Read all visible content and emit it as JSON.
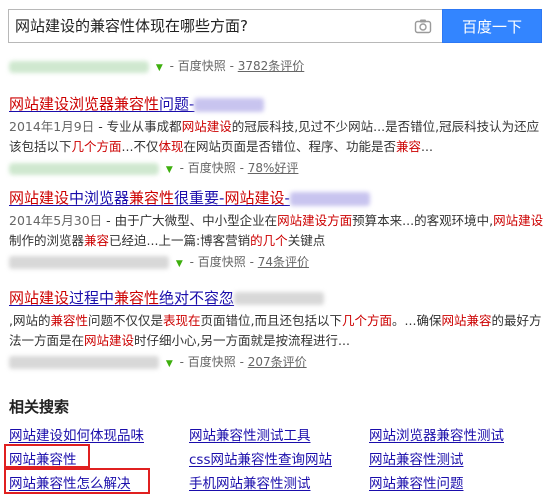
{
  "search": {
    "query": "网站建设的兼容性体现在哪些方面?",
    "button_label": "百度一下"
  },
  "top_meta": {
    "snapshot": "百度快照",
    "reviews": "3782条评价"
  },
  "results": [
    {
      "title_parts": [
        {
          "t": "网站建设浏览器",
          "hl": true
        },
        {
          "t": "兼容性",
          "hl": true
        },
        {
          "t": "问题-",
          "hl": false
        }
      ],
      "abstract_parts": [
        {
          "t": "2014年1月9日",
          "c": "date"
        },
        {
          "t": " - 专业从事成都"
        },
        {
          "t": "网站建设",
          "c": "hl"
        },
        {
          "t": "的冠辰科技,见过不少网站...是否错位,冠辰科技认为还应该包括以下"
        },
        {
          "t": "几个方面",
          "c": "hl"
        },
        {
          "t": "...不仅"
        },
        {
          "t": "体现",
          "c": "hl"
        },
        {
          "t": "在网站页面是否错位、程序、功能是否"
        },
        {
          "t": "兼容",
          "c": "hl"
        },
        {
          "t": "..."
        }
      ],
      "snapshot": "百度快照",
      "rating": "78%好评"
    },
    {
      "title_parts": [
        {
          "t": "网站建设",
          "hl": true
        },
        {
          "t": "中浏览器",
          "hl": false
        },
        {
          "t": "兼容性",
          "hl": true
        },
        {
          "t": "很重要-",
          "hl": false
        },
        {
          "t": "网站建设",
          "hl": true
        },
        {
          "t": "-",
          "hl": false
        }
      ],
      "abstract_parts": [
        {
          "t": "2014年5月30日",
          "c": "date"
        },
        {
          "t": " - 由于广大微型、中小型企业在"
        },
        {
          "t": "网站建设方面",
          "c": "hl"
        },
        {
          "t": "预算本来..."
        },
        {
          "t": "的客观环境中,"
        },
        {
          "t": "网站建设",
          "c": "hl"
        },
        {
          "t": "制作的浏览器"
        },
        {
          "t": "兼容",
          "c": "hl"
        },
        {
          "t": "已经迫...上一篇:博客营销"
        },
        {
          "t": "的几个",
          "c": "hl"
        },
        {
          "t": "关键点"
        }
      ],
      "snapshot": "百度快照",
      "rating": "74条评价"
    },
    {
      "title_parts": [
        {
          "t": "网站建设",
          "hl": true
        },
        {
          "t": "过程中",
          "hl": false
        },
        {
          "t": "兼容性",
          "hl": true
        },
        {
          "t": "绝对不容忽",
          "hl": false
        }
      ],
      "abstract_parts": [
        {
          "t": ",网站的"
        },
        {
          "t": "兼容性",
          "c": "hl"
        },
        {
          "t": "问题不仅仅是"
        },
        {
          "t": "表现在",
          "c": "hl"
        },
        {
          "t": "页面错位,而且还包括以下"
        },
        {
          "t": "几个方面",
          "c": "hl"
        },
        {
          "t": "。...确保"
        },
        {
          "t": "网站兼容",
          "c": "hl"
        },
        {
          "t": "的最好方法一方面是在"
        },
        {
          "t": "网站建设",
          "c": "hl"
        },
        {
          "t": "时仔细小心,另一方面就是按流程进行..."
        }
      ],
      "snapshot": "百度快照",
      "rating": "207条评价"
    }
  ],
  "related": {
    "title": "相关搜索",
    "items": [
      "网站建设如何体现品味",
      "网站兼容性测试工具",
      "网站浏览器兼容性测试",
      "网站兼容性",
      "css网站兼容性查询网站",
      "网站兼容性测试",
      "网站兼容性怎么解决",
      "手机网站兼容性测试",
      "网站兼容性问题"
    ]
  },
  "colors": {
    "link": "#1a0dab",
    "highlight": "#cc0000",
    "button": "#3385ff",
    "annotation_box": "#e02020"
  }
}
